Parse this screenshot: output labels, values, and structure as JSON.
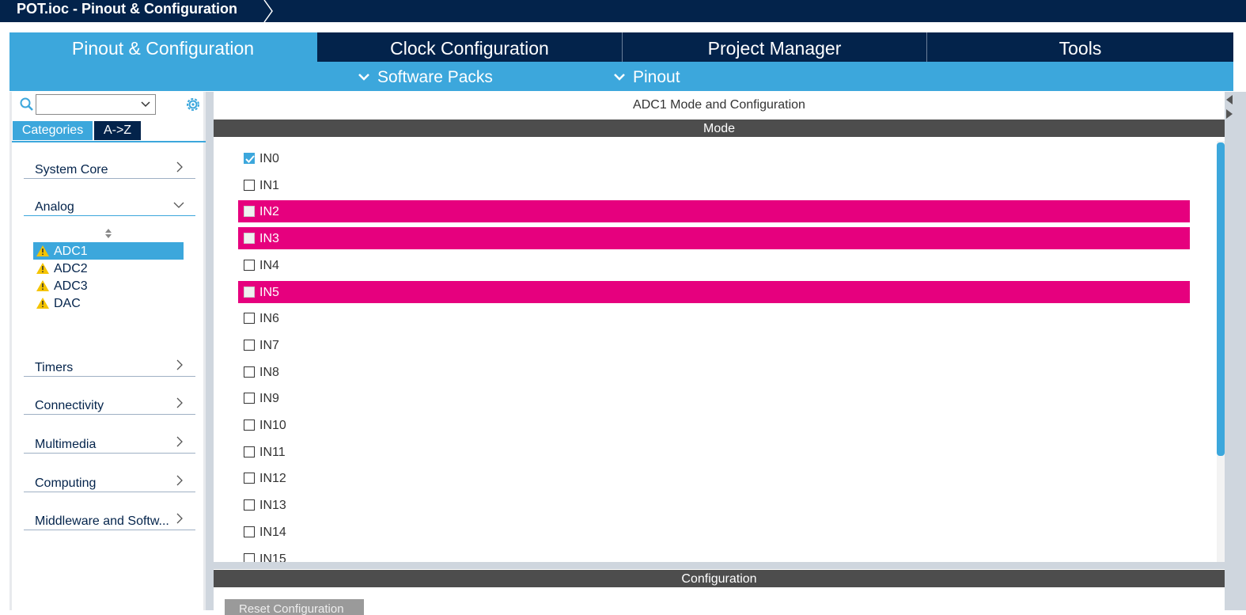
{
  "window": {
    "title": "POT.ioc - Pinout & Configuration"
  },
  "tabs": [
    {
      "label": "Pinout & Configuration",
      "active": true
    },
    {
      "label": "Clock Configuration",
      "active": false
    },
    {
      "label": "Project Manager",
      "active": false
    },
    {
      "label": "Tools",
      "active": false
    }
  ],
  "subtabs": [
    {
      "label": "Software Packs"
    },
    {
      "label": "Pinout"
    }
  ],
  "sidebar": {
    "view_tabs": [
      {
        "label": "Categories",
        "active": true
      },
      {
        "label": "A->Z",
        "active": false
      }
    ],
    "categories": [
      {
        "label": "System Core",
        "expanded": false
      },
      {
        "label": "Analog",
        "expanded": true
      },
      {
        "label": "Timers",
        "expanded": false
      },
      {
        "label": "Connectivity",
        "expanded": false
      },
      {
        "label": "Multimedia",
        "expanded": false
      },
      {
        "label": "Computing",
        "expanded": false
      },
      {
        "label": "Middleware and Softw...",
        "expanded": false
      }
    ],
    "analog_items": [
      {
        "label": "ADC1",
        "selected": true,
        "icon": "warning-icon"
      },
      {
        "label": "ADC2",
        "selected": false,
        "icon": "warning-icon"
      },
      {
        "label": "ADC3",
        "selected": false,
        "icon": "warning-icon"
      },
      {
        "label": "DAC",
        "selected": false,
        "icon": "warning-icon"
      }
    ]
  },
  "main": {
    "title": "ADC1 Mode and Configuration",
    "mode_header": "Mode",
    "config_header": "Configuration",
    "reset_button": "Reset Configuration",
    "channels": [
      {
        "label": "IN0",
        "checked": true,
        "conflict": false
      },
      {
        "label": "IN1",
        "checked": false,
        "conflict": false
      },
      {
        "label": "IN2",
        "checked": false,
        "conflict": true
      },
      {
        "label": "IN3",
        "checked": false,
        "conflict": true
      },
      {
        "label": "IN4",
        "checked": false,
        "conflict": false
      },
      {
        "label": "IN5",
        "checked": false,
        "conflict": true
      },
      {
        "label": "IN6",
        "checked": false,
        "conflict": false
      },
      {
        "label": "IN7",
        "checked": false,
        "conflict": false
      },
      {
        "label": "IN8",
        "checked": false,
        "conflict": false
      },
      {
        "label": "IN9",
        "checked": false,
        "conflict": false
      },
      {
        "label": "IN10",
        "checked": false,
        "conflict": false
      },
      {
        "label": "IN11",
        "checked": false,
        "conflict": false
      },
      {
        "label": "IN12",
        "checked": false,
        "conflict": false
      },
      {
        "label": "IN13",
        "checked": false,
        "conflict": false
      },
      {
        "label": "IN14",
        "checked": false,
        "conflict": false
      },
      {
        "label": "IN15",
        "checked": false,
        "conflict": false
      }
    ]
  },
  "colors": {
    "navy": "#03234b",
    "accent": "#3ca7dc",
    "conflict": "#e6007e",
    "warning": "#f5c400"
  }
}
